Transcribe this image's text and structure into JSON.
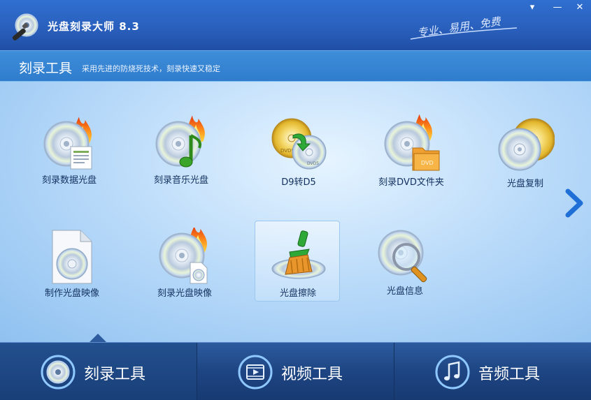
{
  "app": {
    "title": "光盘刻录大师 8.3",
    "slogan": "专业、易用、免费",
    "window_buttons": {
      "menu": "▾",
      "minimize": "—",
      "close": "✕"
    }
  },
  "section": {
    "title": "刻录工具",
    "description": "采用先进的防烧死技术，刻录快速又稳定"
  },
  "tools": [
    {
      "label": "刻录数据光盘",
      "icon": "data-disc-burn-icon"
    },
    {
      "label": "刻录音乐光盘",
      "icon": "music-disc-burn-icon"
    },
    {
      "label": "D9转D5",
      "icon": "d9-to-d5-icon"
    },
    {
      "label": "刻录DVD文件夹",
      "icon": "dvd-folder-burn-icon"
    },
    {
      "label": "光盘复制",
      "icon": "disc-copy-icon"
    },
    {
      "label": "制作光盘映像",
      "icon": "make-disc-image-icon"
    },
    {
      "label": "刻录光盘映像",
      "icon": "burn-disc-image-icon"
    },
    {
      "label": "光盘擦除",
      "icon": "disc-erase-icon",
      "selected": true
    },
    {
      "label": "光盘信息",
      "icon": "disc-info-icon"
    }
  ],
  "tool_icon_text": {
    "dvd_left": "DVD9",
    "dvd_right": "DVD5",
    "folder": "DVD"
  },
  "tabs": [
    {
      "label": "刻录工具",
      "icon": "disc-burn-icon",
      "active": true
    },
    {
      "label": "视频工具",
      "icon": "film-icon",
      "active": false
    },
    {
      "label": "音频工具",
      "icon": "music-note-icon",
      "active": false
    }
  ],
  "colors": {
    "accent": "#2f6fd0",
    "tab_bar": "#1e4583",
    "label": "#13315f"
  }
}
